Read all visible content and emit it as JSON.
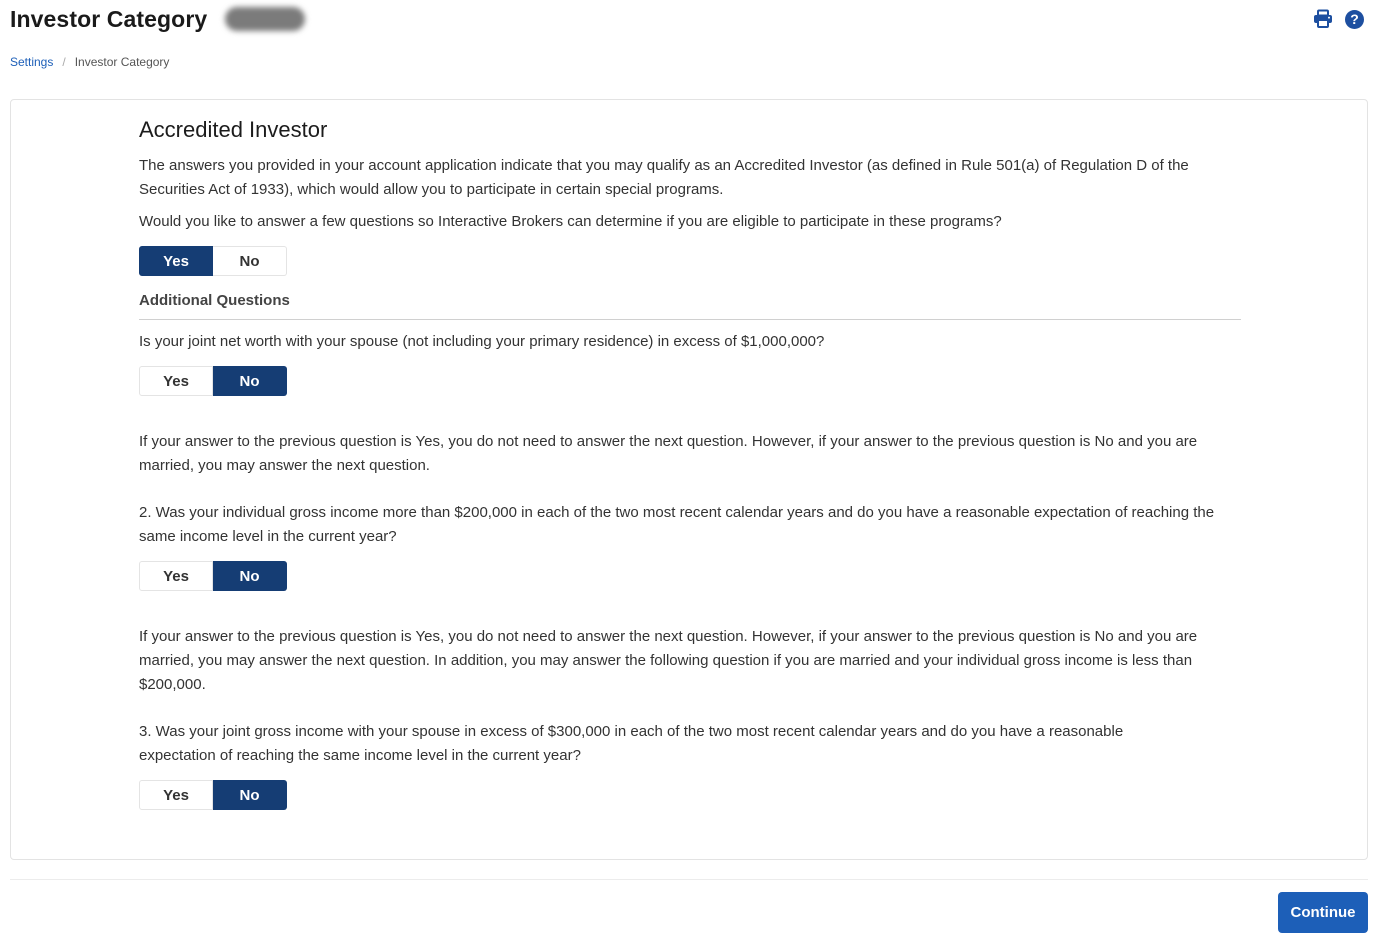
{
  "header": {
    "title": "Investor Category",
    "icons": {
      "print": "print-icon",
      "help": "help-icon"
    },
    "help_glyph": "?"
  },
  "breadcrumb": {
    "items": [
      {
        "label": "Settings",
        "link": true
      },
      {
        "label": "Investor Category",
        "link": false
      }
    ],
    "separator": "/"
  },
  "form": {
    "title": "Accredited Investor",
    "intro_text": "The answers you provided in your account application indicate that you may qualify as an Accredited Investor (as defined in Rule 501(a) of Regulation D of the Securities Act of 1933), which would allow you to participate in certain special programs.",
    "eligibility_question": "Would you like to answer a few questions so Interactive Brokers can determine if you are eligible to participate in these programs?",
    "eligibility_toggle": {
      "yes_label": "Yes",
      "no_label": "No",
      "selected": "Yes"
    },
    "additional_heading": "Additional Questions",
    "q1": {
      "text": "Is your joint net worth with your spouse (not including your primary residence) in excess of $1,000,000?",
      "toggle": {
        "yes_label": "Yes",
        "no_label": "No",
        "selected": "No"
      }
    },
    "note1": "If your answer to the previous question is Yes, you do not need to answer the next question. However, if your answer to the previous question is No and you are married, you may answer the next question.",
    "q2": {
      "text": "2. Was your individual gross income more than $200,000 in each of the two most recent calendar years and do you have a reasonable expectation of reaching the same income level in the current year?",
      "toggle": {
        "yes_label": "Yes",
        "no_label": "No",
        "selected": "No"
      }
    },
    "note2": "If your answer to the previous question is Yes, you do not need to answer the next question. However, if your answer to the previous question is No and you are married, you may answer the next question. In addition, you may answer the following question if you are married and your individual gross income is less than $200,000.",
    "q3": {
      "text": "3. Was your joint gross income with your spouse in excess of $300,000 in each of the two most recent calendar years and do you have a reasonable expectation of reaching the same income level in the current year?",
      "toggle": {
        "yes_label": "Yes",
        "no_label": "No",
        "selected": "No"
      }
    }
  },
  "footer": {
    "continue_label": "Continue"
  },
  "colors": {
    "primary_dark": "#153d74",
    "primary": "#1d5fb8",
    "link": "#1d5fb8"
  }
}
